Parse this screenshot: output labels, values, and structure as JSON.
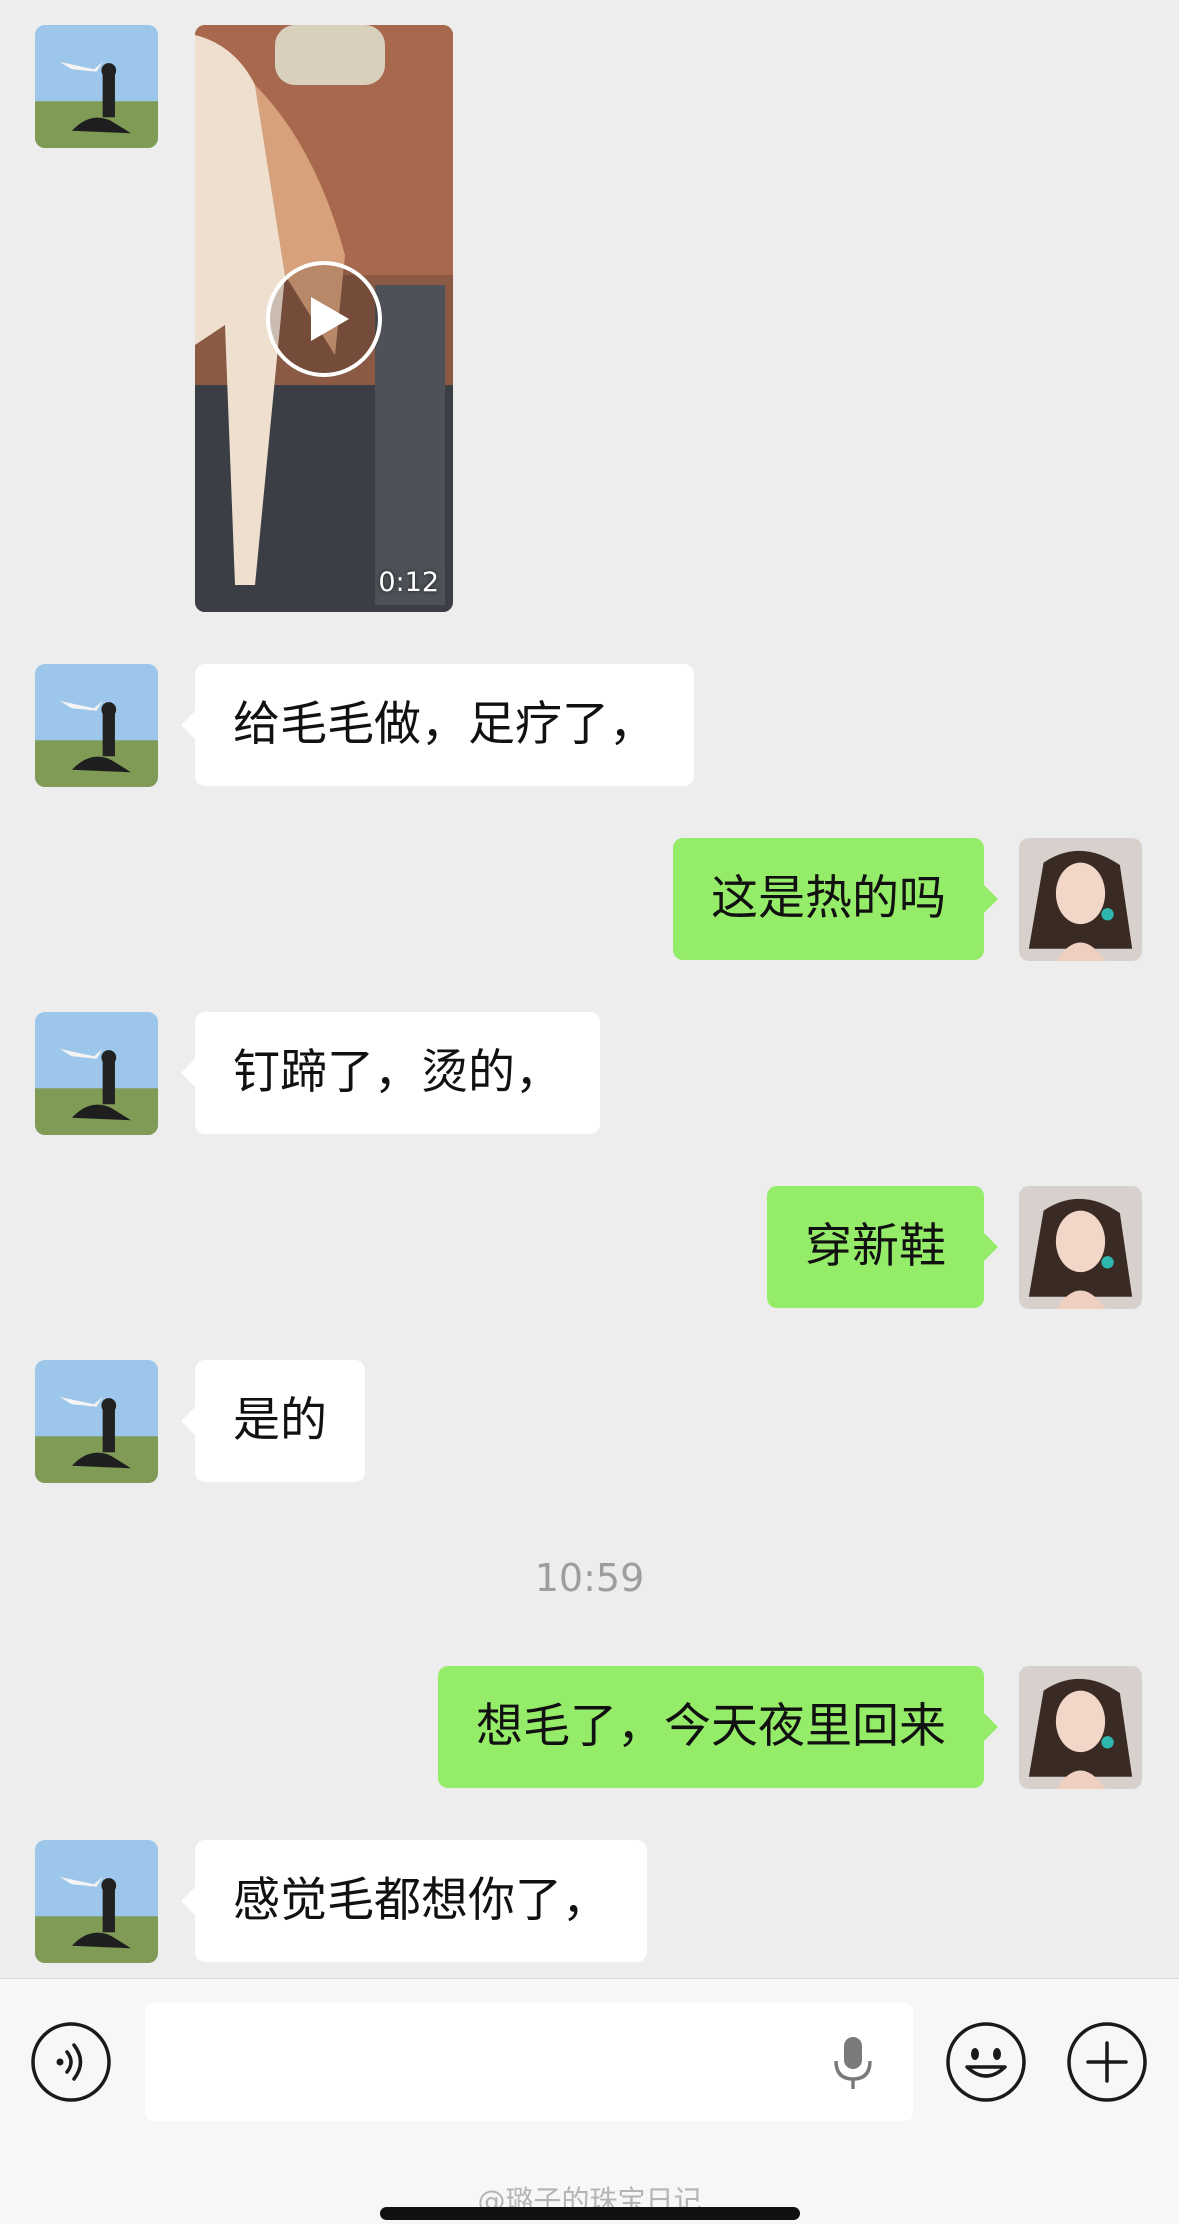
{
  "messages": {
    "video_duration": "0:12",
    "m1": "给毛毛做，足疗了，",
    "m2": "这是热的吗",
    "m3": "钉蹄了，烫的，",
    "m4": "穿新鞋",
    "m5": "是的",
    "time_separator": "10:59",
    "m6": "想毛了，今天夜里回来",
    "m7": "感觉毛都想你了，"
  },
  "input_bar": {
    "voice_icon": "voice-wave-icon",
    "mic_icon": "microphone-icon",
    "emoji_icon": "emoji-icon",
    "plus_icon": "plus-icon",
    "watermark": "@璐子的珠宝日记"
  },
  "colors": {
    "background": "#ededed",
    "outgoing_bubble": "#95ec69",
    "incoming_bubble": "#ffffff"
  }
}
